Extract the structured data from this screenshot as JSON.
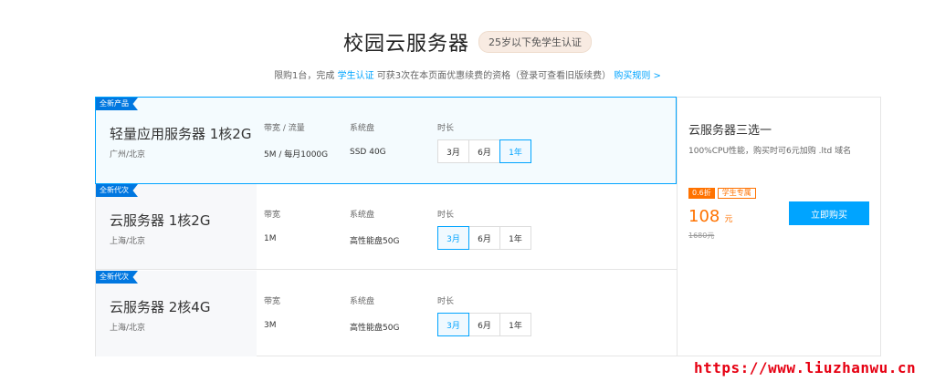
{
  "header": {
    "title": "校园云服务器",
    "badge": "25岁以下免学生认证",
    "subtitle_prefix": "限购1台，完成",
    "subtitle_link": "学生认证",
    "subtitle_suffix": "可获3次在本页面优惠续费的资格（登录可查看旧版续费）",
    "rules_link": "购买规则 >"
  },
  "products": [
    {
      "tag": "全新产品",
      "name": "轻量应用服务器 1核2G",
      "region": "广州/北京",
      "bandwidth_label": "带宽 / 流量",
      "bandwidth_value": "5M / 每月1000G",
      "disk_label": "系统盘",
      "disk_value": "SSD 40G",
      "duration_label": "时长",
      "durations": [
        "3月",
        "6月",
        "1年"
      ],
      "active_duration": 2
    },
    {
      "tag": "全新代次",
      "name": "云服务器 1核2G",
      "region": "上海/北京",
      "bandwidth_label": "带宽",
      "bandwidth_value": "1M",
      "disk_label": "系统盘",
      "disk_value": "高性能盘50G",
      "duration_label": "时长",
      "durations": [
        "3月",
        "6月",
        "1年"
      ],
      "active_duration": 0
    },
    {
      "tag": "全新代次",
      "name": "云服务器 2核4G",
      "region": "上海/北京",
      "bandwidth_label": "带宽",
      "bandwidth_value": "3M",
      "disk_label": "系统盘",
      "disk_value": "高性能盘50G",
      "duration_label": "时长",
      "durations": [
        "3月",
        "6月",
        "1年"
      ],
      "active_duration": 0
    }
  ],
  "side": {
    "title": "云服务器三选一",
    "desc": "100%CPU性能，购买时可6元加购 .ltd 域名",
    "discount": "0.6折",
    "student_tag": "学生专属",
    "price": "108",
    "unit": "元",
    "original_price": "1680元",
    "buy_label": "立即购买"
  },
  "watermark": "https://www.liuzhanwu.cn",
  "colors": {
    "accent": "#00a4ff",
    "tag": "#0077e0",
    "price": "#ff7200",
    "watermark": "#e60012"
  }
}
